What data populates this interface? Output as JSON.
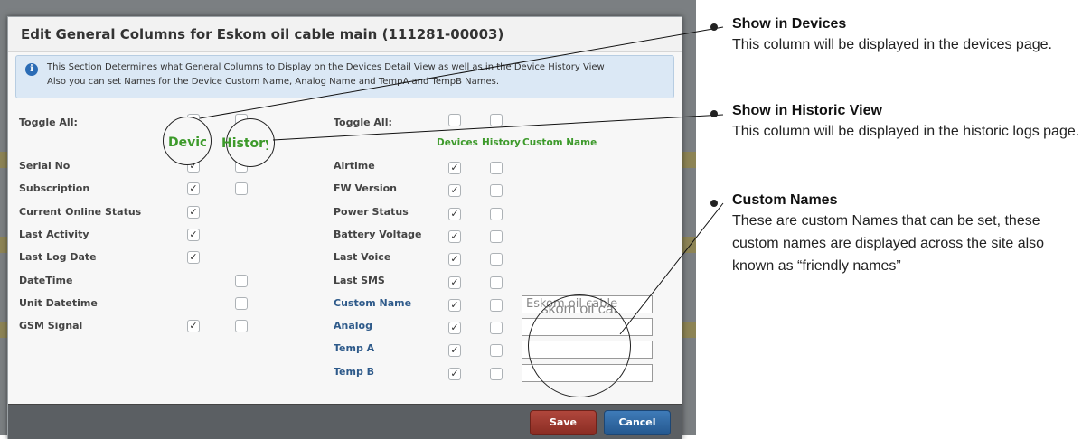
{
  "dialog": {
    "title": "Edit General Columns for Eskom oil cable main (111281-00003)",
    "info_line1": "This Section Determines what General Columns to Display on the Devices Detail View as well as in the Device History View",
    "info_line2": "Also you can set Names for the Device Custom Name, Analog Name and TempA and TempB Names."
  },
  "left_table": {
    "toggle_all_label": "Toggle All:",
    "devices_label": "Devices",
    "history_label": "History",
    "rows": [
      {
        "label": "Serial No",
        "devices": true,
        "history": false
      },
      {
        "label": "Subscription",
        "devices": true,
        "history": false
      },
      {
        "label": "Current Online Status",
        "devices": true,
        "history": null
      },
      {
        "label": "Last Activity",
        "devices": true,
        "history": null
      },
      {
        "label": "Last Log Date",
        "devices": true,
        "history": null
      },
      {
        "label": "DateTime",
        "devices": null,
        "history": false
      },
      {
        "label": "Unit Datetime",
        "devices": null,
        "history": false
      },
      {
        "label": "GSM Signal",
        "devices": true,
        "history": false
      }
    ]
  },
  "right_table": {
    "toggle_all_label": "Toggle All:",
    "devices_label": "Devices",
    "history_label": "History",
    "custom_name_label": "Custom Name",
    "rows": [
      {
        "label": "Airtime",
        "devices": true,
        "history": false
      },
      {
        "label": "FW Version",
        "devices": true,
        "history": false
      },
      {
        "label": "Power Status",
        "devices": true,
        "history": false
      },
      {
        "label": "Battery Voltage",
        "devices": true,
        "history": false
      },
      {
        "label": "Last Voice",
        "devices": true,
        "history": false
      },
      {
        "label": "Last SMS",
        "devices": true,
        "history": false
      },
      {
        "label": "Custom Name",
        "devices": true,
        "history": false,
        "input": "Eskom oil cable main"
      },
      {
        "label": "Analog",
        "devices": true,
        "history": false,
        "input": ""
      },
      {
        "label": "Temp A",
        "devices": true,
        "history": false,
        "input": ""
      },
      {
        "label": "Temp B",
        "devices": true,
        "history": false,
        "input": ""
      }
    ]
  },
  "magnified": {
    "devices": "Devices",
    "history": "History",
    "custom_name": "Eskom oil cable main"
  },
  "footer": {
    "save_label": "Save",
    "cancel_label": "Cancel"
  },
  "annotations": [
    {
      "title": "Show in Devices",
      "body": "This column will be displayed in the devices page."
    },
    {
      "title": "Show in Historic View",
      "body": "This column will be displayed in the historic logs page."
    },
    {
      "title": "Custom Names",
      "body": "These are custom Names that can be set, these custom names are displayed across the site also known as “friendly names”"
    }
  ],
  "colors": {
    "save": "#9b3a30",
    "cancel": "#2d66a3",
    "green_header": "#3d9a2b",
    "blue_label": "#2e5a8a"
  }
}
